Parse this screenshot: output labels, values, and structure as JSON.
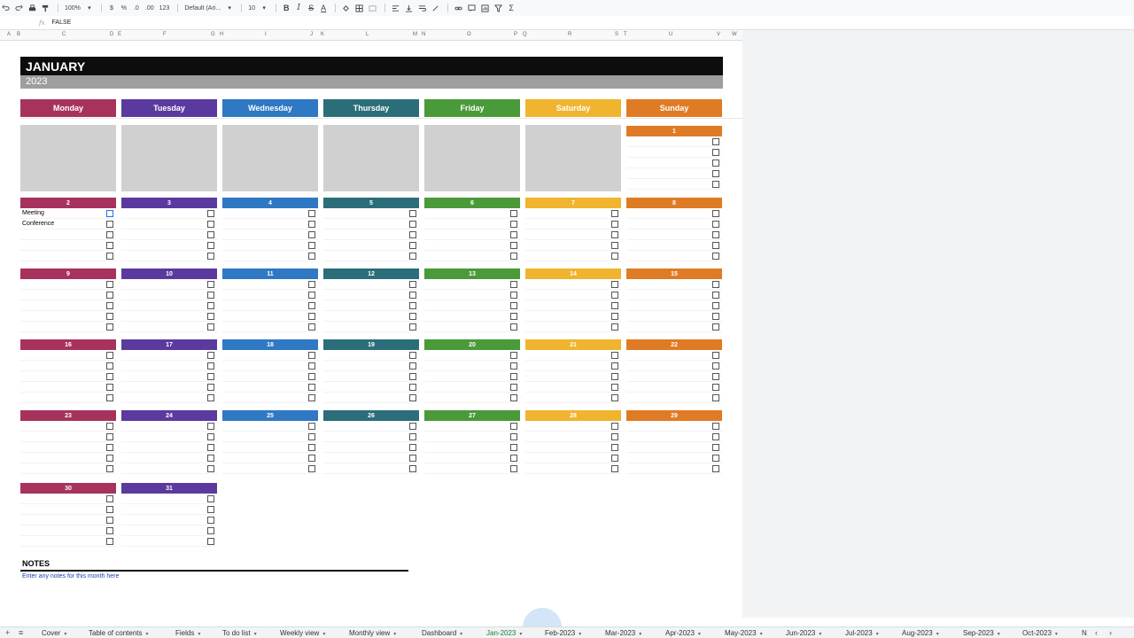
{
  "toolbar": {
    "zoom": "100%",
    "currency": "$",
    "percent": "%",
    "dec_less": ".0",
    "dec_more": ".00",
    "format_more": "123",
    "font": "Default (Ari...",
    "font_size": "10"
  },
  "formula": {
    "fx": "fx",
    "value": "FALSE"
  },
  "columns": [
    "A",
    "B",
    "C",
    "D",
    "E",
    "F",
    "G",
    "H",
    "I",
    "J",
    "K",
    "L",
    "M",
    "N",
    "O",
    "P",
    "Q",
    "R",
    "S",
    "T",
    "U",
    "V",
    "W"
  ],
  "calendar": {
    "month": "JANUARY",
    "year": "2023",
    "days": [
      "Monday",
      "Tuesday",
      "Wednesday",
      "Thursday",
      "Friday",
      "Saturday",
      "Sunday"
    ],
    "colors": [
      "#a8325e",
      "#5b3aa0",
      "#2f78c4",
      "#2b6e7a",
      "#4a9a3a",
      "#f0b42e",
      "#e07b25"
    ],
    "dates": [
      "1",
      "2",
      "3",
      "4",
      "5",
      "6",
      "7",
      "8",
      "9",
      "10",
      "11",
      "12",
      "13",
      "14",
      "15",
      "16",
      "17",
      "18",
      "19",
      "20",
      "21",
      "22",
      "23",
      "24",
      "25",
      "26",
      "27",
      "28",
      "29",
      "30",
      "31"
    ],
    "tasks": [
      "Meeting",
      "Conference"
    ]
  },
  "notes": {
    "title": "NOTES",
    "placeholder": "Enter any notes for this month here"
  },
  "tabs": {
    "items": [
      "Cover",
      "Table of contents",
      "Fields",
      "To do list",
      "Weekly view",
      "Monthly view",
      "Dashboard",
      "Jan-2023",
      "Feb-2023",
      "Mar-2023",
      "Apr-2023",
      "May-2023",
      "Jun-2023",
      "Jul-2023",
      "Aug-2023",
      "Sep-2023",
      "Oct-2023",
      "N"
    ],
    "active": "Jan-2023"
  }
}
